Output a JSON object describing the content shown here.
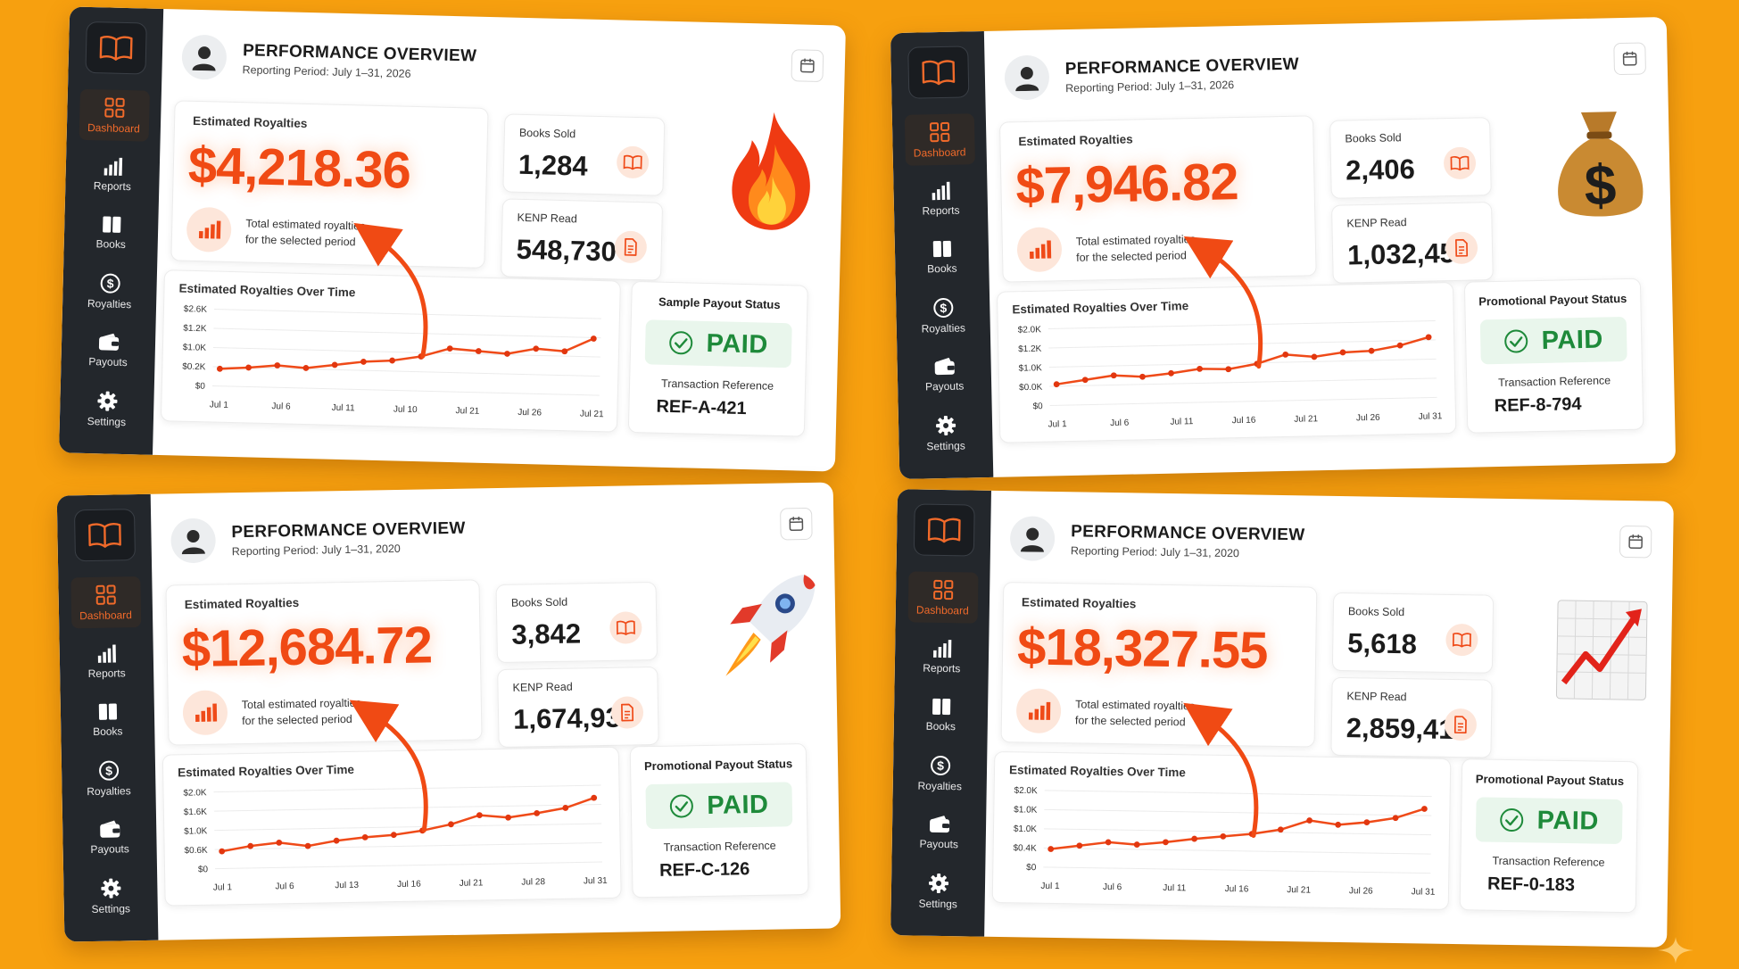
{
  "colors": {
    "background": "#f7a00f",
    "accent": "#f04a14",
    "sidebar": "#23272c",
    "paid_green": "#1e8a3a"
  },
  "panels": [
    {
      "title": "PERFORMANCE OVERVIEW",
      "period": "Reporting Period: July 1–31, 2026",
      "nav": [
        "Dashboard",
        "Reports",
        "Books",
        "Royalties",
        "Payouts",
        "Settings"
      ],
      "royalties": {
        "label": "Estimated Royalties",
        "amount": "$4,218.36",
        "desc_line1": "Total estimated royalties",
        "desc_line2": "for the selected period"
      },
      "books_sold": {
        "label": "Books Sold",
        "value": "1,284"
      },
      "kenp_read": {
        "label": "KENP Read",
        "value": "548,730"
      },
      "emoji": "fire-icon",
      "payout": {
        "title": "Sample Payout Status",
        "status": "PAID",
        "ref_label": "Transaction Reference",
        "ref_value": "REF-A-421"
      }
    },
    {
      "title": "PERFORMANCE OVERVIEW",
      "period": "Reporting Period: July 1–31, 2026",
      "nav": [
        "Dashboard",
        "Reports",
        "Books",
        "Royalties",
        "Payouts",
        "Settings"
      ],
      "royalties": {
        "label": "Estimated Royalties",
        "amount": "$7,946.82",
        "desc_line1": "Total estimated royalties",
        "desc_line2": "for the selected period"
      },
      "books_sold": {
        "label": "Books Sold",
        "value": "2,406"
      },
      "kenp_read": {
        "label": "KENP Read",
        "value": "1,032,450"
      },
      "emoji": "money-bag-icon",
      "payout": {
        "title": "Promotional Payout Status",
        "status": "PAID",
        "ref_label": "Transaction Reference",
        "ref_value": "REF-8-794"
      }
    },
    {
      "title": "PERFORMANCE OVERVIEW",
      "period": "Reporting Period: July 1–31, 2020",
      "nav": [
        "Dashboard",
        "Reports",
        "Books",
        "Royalties",
        "Payouts",
        "Settings"
      ],
      "royalties": {
        "label": "Estimated Royalties",
        "amount": "$12,684.72",
        "desc_line1": "Total estimated royalties",
        "desc_line2": "for the selected period"
      },
      "books_sold": {
        "label": "Books Sold",
        "value": "3,842"
      },
      "kenp_read": {
        "label": "KENP Read",
        "value": "1,674,930"
      },
      "emoji": "rocket-icon",
      "payout": {
        "title": "Promotional Payout Status",
        "status": "PAID",
        "ref_label": "Transaction Reference",
        "ref_value": "REF-C-126"
      }
    },
    {
      "title": "PERFORMANCE OVERVIEW",
      "period": "Reporting Period: July 1–31, 2020",
      "nav": [
        "Dashboard",
        "Reports",
        "Books",
        "Royalties",
        "Payouts",
        "Settings"
      ],
      "royalties": {
        "label": "Estimated Royalties",
        "amount": "$18,327.55",
        "desc_line1": "Total estimated royalties",
        "desc_line2": "for the selected period"
      },
      "books_sold": {
        "label": "Books Sold",
        "value": "5,618"
      },
      "kenp_read": {
        "label": "KENP Read",
        "value": "2,859,410"
      },
      "emoji": "chart-increasing-icon",
      "payout": {
        "title": "Promotional Payout Status",
        "status": "PAID",
        "ref_label": "Transaction Reference",
        "ref_value": "REF-0-183"
      }
    }
  ],
  "chart_data": [
    {
      "type": "line",
      "title": "Estimated Royalties Over Time",
      "x": [
        "Jul 1",
        "Jul 6",
        "Jul 11",
        "Jul 10",
        "Jul 21",
        "Jul 26",
        "Jul 21"
      ],
      "y_ticks": [
        "$0",
        "$0.2K",
        "$1.0K",
        "$1.2K",
        "$2.6K"
      ],
      "ylim": [
        0,
        4
      ],
      "series": [
        {
          "values": [
            0.9,
            1.0,
            1.15,
            1.05,
            1.25,
            1.45,
            1.55,
            1.8,
            2.25,
            2.15,
            2.05,
            2.35,
            2.25,
            2.95
          ]
        }
      ]
    },
    {
      "type": "line",
      "title": "Estimated Royalties Over Time",
      "x": [
        "Jul 1",
        "Jul 6",
        "Jul 11",
        "Jul 16",
        "Jul 21",
        "Jul 26",
        "Jul 31"
      ],
      "y_ticks": [
        "$0",
        "$0.0K",
        "$1.0K",
        "$1.2K",
        "$2.0K"
      ],
      "ylim": [
        0,
        4
      ],
      "series": [
        {
          "values": [
            1.1,
            1.3,
            1.5,
            1.4,
            1.55,
            1.75,
            1.7,
            1.95,
            2.4,
            2.25,
            2.45,
            2.5,
            2.75,
            3.15
          ]
        }
      ]
    },
    {
      "type": "line",
      "title": "Estimated Royalties Over Time",
      "x": [
        "Jul 1",
        "Jul 6",
        "Jul 13",
        "Jul 16",
        "Jul 21",
        "Jul 28",
        "Jul 31"
      ],
      "y_ticks": [
        "$0",
        "$0.6K",
        "$1.0K",
        "$1.6K",
        "$2.0K"
      ],
      "ylim": [
        0,
        4
      ],
      "series": [
        {
          "values": [
            0.9,
            1.15,
            1.3,
            1.1,
            1.35,
            1.5,
            1.6,
            1.8,
            2.1,
            2.55,
            2.4,
            2.6,
            2.85,
            3.35
          ]
        }
      ]
    },
    {
      "type": "line",
      "title": "Estimated Royalties Over Time",
      "x": [
        "Jul 1",
        "Jul 6",
        "Jul 11",
        "Jul 16",
        "Jul 21",
        "Jul 26",
        "Jul 31"
      ],
      "y_ticks": [
        "$0",
        "$0.4K",
        "$1.0K",
        "$1.0K",
        "$2.0K"
      ],
      "ylim": [
        0,
        4
      ],
      "series": [
        {
          "values": [
            0.95,
            1.15,
            1.35,
            1.25,
            1.4,
            1.6,
            1.75,
            1.9,
            2.15,
            2.65,
            2.45,
            2.6,
            2.85,
            3.35
          ]
        }
      ]
    }
  ]
}
